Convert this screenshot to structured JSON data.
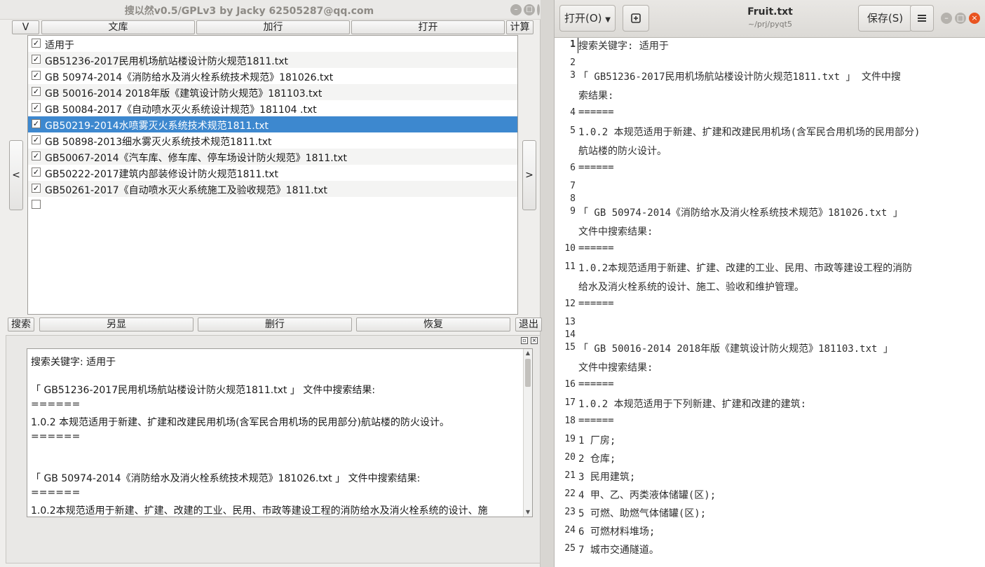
{
  "left_window": {
    "title": "搜以然v0.5/GPLv3 by Jacky 62505287@qq.com",
    "top_buttons": {
      "v": "V",
      "library": "文库",
      "add_line": "加行",
      "open": "打开",
      "calc": "计算"
    },
    "prev_label": "<",
    "next_label": ">",
    "file_rows": [
      {
        "label": "适用于",
        "checked": true
      },
      {
        "label": "GB51236-2017民用机场航站楼设计防火规范1811.txt",
        "checked": true
      },
      {
        "label": "GB 50974-2014《消防给水及消火栓系统技术规范》181026.txt",
        "checked": true
      },
      {
        "label": "GB 50016-2014  2018年版《建筑设计防火规范》181103.txt",
        "checked": true
      },
      {
        "label": "GB 50084-2017《自动喷水灭火系统设计规范》181104 .txt",
        "checked": true
      },
      {
        "label": "GB50219-2014水喷雾灭火系统技术规范1811.txt",
        "checked": true,
        "selected": true
      },
      {
        "label": "GB 50898-2013细水雾灭火系统技术规范1811.txt",
        "checked": true
      },
      {
        "label": "GB50067-2014《汽车库、修车库、停车场设计防火规范》1811.txt",
        "checked": true
      },
      {
        "label": "GB50222-2017建筑内部装修设计防火规范1811.txt",
        "checked": true
      },
      {
        "label": "GB50261-2017《自动喷水灭火系统施工及验收规范》1811.txt",
        "checked": true
      },
      {
        "label": "",
        "checked": false
      }
    ],
    "bottom_buttons": {
      "search": "搜索",
      "alt_show": "另显",
      "delete_line": "删行",
      "restore": "恢复",
      "exit": "退出"
    },
    "result_lines": [
      "搜索关键字:                适用于",
      "",
      "             「 GB51236-2017民用机场航站楼设计防火规范1811.txt 」   文件中搜索结果:",
      "======",
      "1.0.2 本规范适用于新建、扩建和改建民用机场(含军民合用机场的民用部分)航站楼的防火设计。",
      "======",
      "",
      "",
      "             「 GB 50974-2014《消防给水及消火栓系统技术规范》181026.txt 」      文件中搜索结果:",
      "======",
      "1.0.2本规范适用于新建、扩建、改建的工业、民用、市政等建设工程的消防给水及消火栓系统的设计、施"
    ]
  },
  "gedit": {
    "open_label": "打开(O)",
    "title": "Fruit.txt",
    "subtitle": "~/prj/pyqt5",
    "save_label": "保存(S)",
    "lines": [
      {
        "n": "1",
        "t": "搜索关键字:  适用于"
      },
      {
        "n": "2",
        "t": ""
      },
      {
        "n": "3",
        "t": "    「 GB51236-2017民用机场航站楼设计防火规范1811.txt 」  文件中搜",
        "wrap": "索结果:"
      },
      {
        "n": "4",
        "t": "======"
      },
      {
        "n": "5",
        "t": "1.0.2 本规范适用于新建、扩建和改建民用机场(含军民合用机场的民用部分)",
        "wrap": "航站楼的防火设计。"
      },
      {
        "n": "6",
        "t": "======"
      },
      {
        "n": "7",
        "t": ""
      },
      {
        "n": "8",
        "t": ""
      },
      {
        "n": "9",
        "t": "    「 GB 50974-2014《消防给水及消火栓系统技术规范》181026.txt 」",
        "wrap": "文件中搜索结果:"
      },
      {
        "n": "10",
        "t": "======"
      },
      {
        "n": "11",
        "t": "1.0.2本规范适用于新建、扩建、改建的工业、民用、市政等建设工程的消防",
        "wrap": "给水及消火栓系统的设计、施工、验收和维护管理。"
      },
      {
        "n": "12",
        "t": "======"
      },
      {
        "n": "13",
        "t": ""
      },
      {
        "n": "14",
        "t": ""
      },
      {
        "n": "15",
        "t": "    「 GB 50016-2014  2018年版《建筑设计防火规范》181103.txt 」",
        "wrap": "文件中搜索结果:"
      },
      {
        "n": "16",
        "t": "======"
      },
      {
        "n": "17",
        "t": "1.0.2 本规范适用于下列新建、扩建和改建的建筑:"
      },
      {
        "n": "18",
        "t": "======"
      },
      {
        "n": "19",
        "t": "1 厂房;"
      },
      {
        "n": "20",
        "t": "2 仓库;"
      },
      {
        "n": "21",
        "t": "3 民用建筑;"
      },
      {
        "n": "22",
        "t": "4 甲、乙、丙类液体储罐(区);"
      },
      {
        "n": "23",
        "t": "5 可燃、助燃气体储罐(区);"
      },
      {
        "n": "24",
        "t": "6 可燃材料堆场;"
      },
      {
        "n": "25",
        "t": "7 城市交通隧道。"
      }
    ]
  }
}
